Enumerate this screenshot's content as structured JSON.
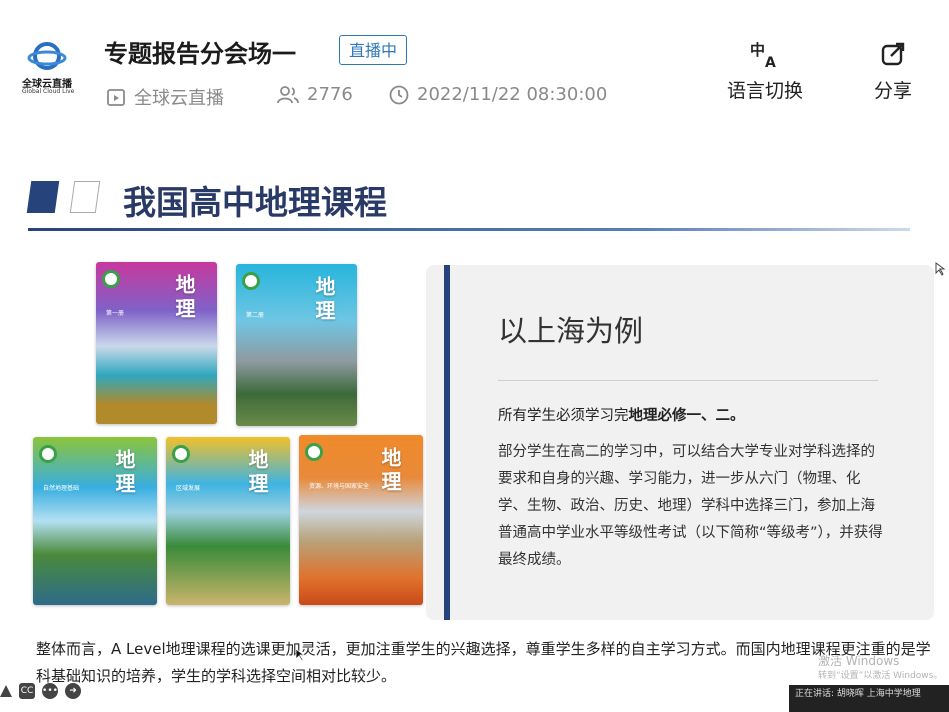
{
  "header": {
    "logo": {
      "name_cn": "全球云直播",
      "name_en": "Global Cloud Live"
    },
    "title": "专题报告分会场一",
    "live_badge": "直播中",
    "channel": "全球云直播",
    "viewers": "2776",
    "datetime": "2022/11/22 08:30:00",
    "language_button": "语言切换",
    "share_button": "分享"
  },
  "slide": {
    "title": "我国高中地理课程",
    "books": [
      {
        "title": "地理",
        "subtitle": "第一册"
      },
      {
        "title": "地理",
        "subtitle": "第二册"
      },
      {
        "title": "地理",
        "subtitle": "自然地理基础"
      },
      {
        "title": "地理",
        "subtitle": "区域发展"
      },
      {
        "title": "地理",
        "subtitle": "资源、环境与国家安全"
      }
    ],
    "panel": {
      "heading": "以上海为例",
      "line1_prefix": "所有学生必须学习完",
      "line1_bold": "地理必修一、二。",
      "paragraph": "部分学生在高二的学习中，可以结合大学专业对学科选择的要求和自身的兴趣、学习能力，进一步从六门（物理、化学、生物、政治、历史、地理）学科中选择三门，参加上海普通高中学业水平等级性考试（以下简称“等级考”），并获得最终成绩。"
    },
    "bottom_text": "整体而言，A Level地理课程的选课更加灵活，更加注重学生的兴趣选择，尊重学生多样的自主学习方式。而国内地理课程更注重的是学科基础知识的培养，学生的学科选择空间相对比较少。"
  },
  "watermark": {
    "line1": "激活 Windows",
    "line2": "转到“设置”以激活 Windows。"
  },
  "controls": {
    "cc": "CC"
  },
  "ticker": "正在讲话: 胡晓晖 上海中学地理"
}
